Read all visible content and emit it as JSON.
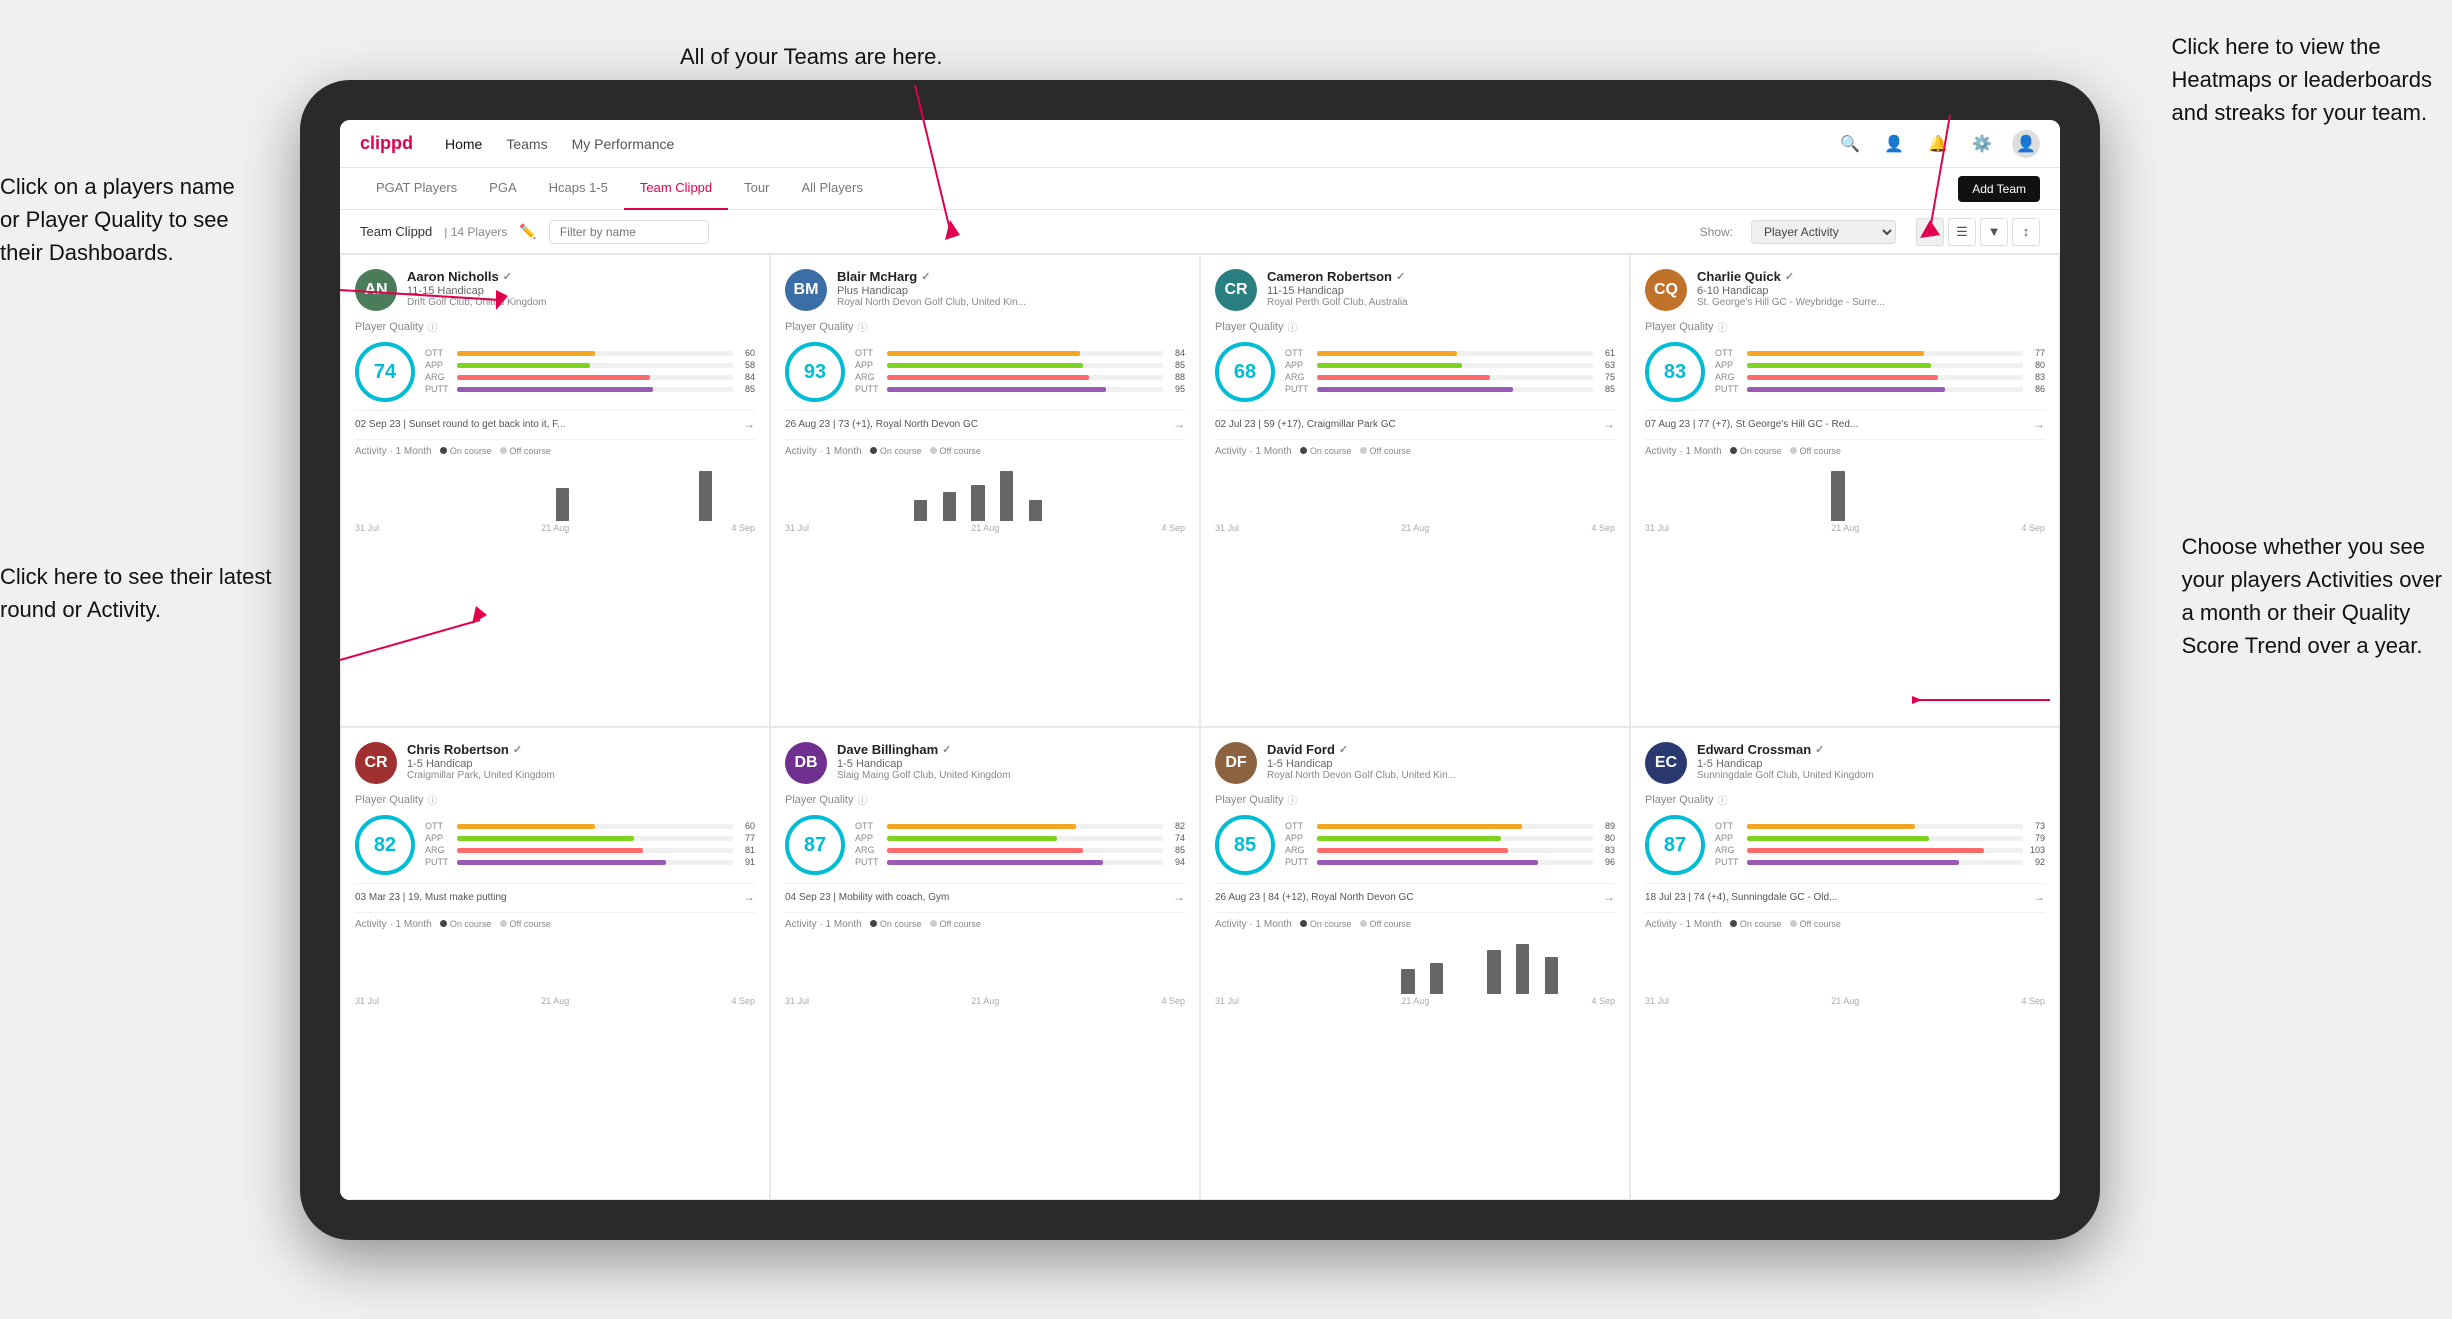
{
  "annotations": {
    "teams_callout": "All of your Teams are here.",
    "heatmaps_callout": "Click here to view the\nHeatmaps or leaderboards\nand streaks for your team.",
    "player_name_callout": "Click on a players name\nor Player Quality to see\ntheir Dashboards.",
    "latest_round_callout": "Click here to see their latest\nround or Activity.",
    "activity_callout": "Choose whether you see\nyour players Activities over\na month or their Quality\nScore Trend over a year."
  },
  "nav": {
    "logo": "clippd",
    "items": [
      "Home",
      "Teams",
      "My Performance"
    ],
    "icons": [
      "search",
      "person",
      "bell",
      "settings",
      "avatar"
    ]
  },
  "sub_tabs": {
    "tabs": [
      "PGAT Players",
      "PGA",
      "Hcaps 1-5",
      "Team Clippd",
      "Tour",
      "All Players"
    ],
    "active": "Team Clippd",
    "add_btn": "Add Team"
  },
  "team_header": {
    "title": "Team Clippd",
    "separator": "|",
    "count": "14 Players",
    "filter_placeholder": "Filter by name",
    "show_label": "Show:",
    "show_value": "Player Activity"
  },
  "players": [
    {
      "id": "aaron-nicholls",
      "name": "Aaron Nicholls",
      "handicap": "11-15 Handicap",
      "club": "Drift Golf Club, United Kingdom",
      "quality": 74,
      "ott": 60,
      "app": 58,
      "arg": 84,
      "putt": 85,
      "latest_round": "02 Sep 23 | Sunset round to get back into it, F...",
      "avatar_color": "avatar-green",
      "initials": "AN",
      "chart_bars": [
        0,
        0,
        0,
        0,
        0,
        0,
        0,
        0,
        0,
        0,
        0,
        0,
        0,
        0,
        2,
        0,
        0,
        0,
        0,
        0,
        0,
        0,
        0,
        0,
        3,
        0,
        0,
        0
      ],
      "chart_labels": [
        "31 Jul",
        "21 Aug",
        "4 Sep"
      ]
    },
    {
      "id": "blair-mcharg",
      "name": "Blair McHarg",
      "handicap": "Plus Handicap",
      "club": "Royal North Devon Golf Club, United Kin...",
      "quality": 93,
      "ott": 84,
      "app": 85,
      "arg": 88,
      "putt": 95,
      "latest_round": "26 Aug 23 | 73 (+1), Royal North Devon GC",
      "avatar_color": "avatar-blue",
      "initials": "BM",
      "chart_bars": [
        0,
        0,
        0,
        0,
        0,
        0,
        0,
        0,
        0,
        3,
        0,
        4,
        0,
        5,
        0,
        7,
        0,
        3,
        0,
        0,
        0,
        0,
        0,
        0,
        0,
        0,
        0,
        0
      ],
      "chart_labels": [
        "31 Jul",
        "21 Aug",
        "4 Sep"
      ]
    },
    {
      "id": "cameron-robertson",
      "name": "Cameron Robertson",
      "handicap": "11-15 Handicap",
      "club": "Royal Perth Golf Club, Australia",
      "quality": 68,
      "ott": 61,
      "app": 63,
      "arg": 75,
      "putt": 85,
      "latest_round": "02 Jul 23 | 59 (+17), Craigmillar Park GC",
      "avatar_color": "avatar-teal",
      "initials": "CR",
      "chart_bars": [
        0,
        0,
        0,
        0,
        0,
        0,
        0,
        0,
        0,
        0,
        0,
        0,
        0,
        0,
        0,
        0,
        0,
        0,
        0,
        0,
        0,
        0,
        0,
        0,
        0,
        0,
        0,
        0
      ],
      "chart_labels": [
        "31 Jul",
        "21 Aug",
        "4 Sep"
      ]
    },
    {
      "id": "charlie-quick",
      "name": "Charlie Quick",
      "handicap": "6-10 Handicap",
      "club": "St. George's Hill GC - Weybridge - Surre...",
      "quality": 83,
      "ott": 77,
      "app": 80,
      "arg": 83,
      "putt": 86,
      "latest_round": "07 Aug 23 | 77 (+7), St George's Hill GC - Red...",
      "avatar_color": "avatar-orange",
      "initials": "CQ",
      "chart_bars": [
        0,
        0,
        0,
        0,
        0,
        0,
        0,
        0,
        0,
        0,
        0,
        0,
        0,
        3,
        0,
        0,
        0,
        0,
        0,
        0,
        0,
        0,
        0,
        0,
        0,
        0,
        0,
        0
      ],
      "chart_labels": [
        "31 Jul",
        "21 Aug",
        "4 Sep"
      ]
    },
    {
      "id": "chris-robertson",
      "name": "Chris Robertson",
      "handicap": "1-5 Handicap",
      "club": "Craigmillar Park, United Kingdom",
      "quality": 82,
      "ott": 60,
      "app": 77,
      "arg": 81,
      "putt": 91,
      "latest_round": "03 Mar 23 | 19, Must make putting",
      "avatar_color": "avatar-red",
      "initials": "CR",
      "chart_bars": [
        0,
        0,
        0,
        0,
        0,
        0,
        0,
        0,
        0,
        0,
        0,
        0,
        0,
        0,
        0,
        0,
        0,
        0,
        0,
        0,
        0,
        0,
        0,
        0,
        0,
        0,
        0,
        0
      ],
      "chart_labels": [
        "31 Jul",
        "21 Aug",
        "4 Sep"
      ]
    },
    {
      "id": "dave-billingham",
      "name": "Dave Billingham",
      "handicap": "1-5 Handicap",
      "club": "Slaig Maing Golf Club, United Kingdom",
      "quality": 87,
      "ott": 82,
      "app": 74,
      "arg": 85,
      "putt": 94,
      "latest_round": "04 Sep 23 | Mobility with coach, Gym",
      "avatar_color": "avatar-purple",
      "initials": "DB",
      "chart_bars": [
        0,
        0,
        0,
        0,
        0,
        0,
        0,
        0,
        0,
        0,
        0,
        0,
        0,
        0,
        0,
        0,
        0,
        0,
        0,
        0,
        0,
        0,
        0,
        0,
        0,
        0,
        0,
        0
      ],
      "chart_labels": [
        "31 Jul",
        "21 Aug",
        "4 Sep"
      ]
    },
    {
      "id": "david-ford",
      "name": "David Ford",
      "handicap": "1-5 Handicap",
      "club": "Royal North Devon Golf Club, United Kin...",
      "quality": 85,
      "ott": 89,
      "app": 80,
      "arg": 83,
      "putt": 96,
      "latest_round": "26 Aug 23 | 84 (+12), Royal North Devon GC",
      "avatar_color": "avatar-brown",
      "initials": "DF",
      "chart_bars": [
        0,
        0,
        0,
        0,
        0,
        0,
        0,
        0,
        0,
        0,
        0,
        0,
        0,
        4,
        0,
        5,
        0,
        0,
        0,
        7,
        0,
        8,
        0,
        6,
        0,
        0,
        0,
        0
      ],
      "chart_labels": [
        "31 Jul",
        "21 Aug",
        "4 Sep"
      ]
    },
    {
      "id": "edward-crossman",
      "name": "Edward Crossman",
      "handicap": "1-5 Handicap",
      "club": "Sunningdale Golf Club, United Kingdom",
      "quality": 87,
      "ott": 73,
      "app": 79,
      "arg": 103,
      "putt": 92,
      "latest_round": "18 Jul 23 | 74 (+4), Sunningdale GC - Old...",
      "avatar_color": "avatar-navy",
      "initials": "EC",
      "chart_bars": [
        0,
        0,
        0,
        0,
        0,
        0,
        0,
        0,
        0,
        0,
        0,
        0,
        0,
        0,
        0,
        0,
        0,
        0,
        0,
        0,
        0,
        0,
        0,
        0,
        0,
        0,
        0,
        0
      ],
      "chart_labels": [
        "31 Jul",
        "21 Aug",
        "4 Sep"
      ]
    }
  ],
  "activity": {
    "title": "Activity · 1 Month",
    "legend_on": "On course",
    "legend_off": "Off course"
  }
}
